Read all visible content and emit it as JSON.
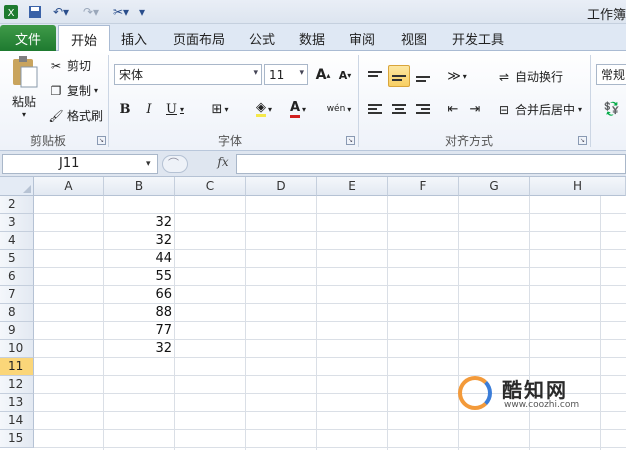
{
  "window": {
    "title": "工作簿"
  },
  "quick_access": {
    "icons": [
      "excel-icon",
      "save-icon",
      "undo-icon",
      "redo-icon",
      "tools-icon",
      "customize-icon"
    ]
  },
  "tabs": {
    "file": "文件",
    "items": [
      {
        "label": "开始",
        "active": true
      },
      {
        "label": "插入",
        "active": false
      },
      {
        "label": "页面布局",
        "active": false
      },
      {
        "label": "公式",
        "active": false
      },
      {
        "label": "数据",
        "active": false
      },
      {
        "label": "审阅",
        "active": false
      },
      {
        "label": "视图",
        "active": false
      },
      {
        "label": "开发工具",
        "active": false
      }
    ]
  },
  "ribbon": {
    "clipboard": {
      "label": "剪贴板",
      "paste": "粘贴",
      "cut": "剪切",
      "copy": "复制",
      "format_painter": "格式刷"
    },
    "font": {
      "label": "字体",
      "font_name": "宋体",
      "font_size": "11",
      "bold": "B",
      "italic": "I",
      "underline": "U",
      "grow": "A",
      "shrink": "A",
      "font_color": "A",
      "wen": "wén"
    },
    "alignment": {
      "label": "对齐方式",
      "wrap_text": "自动换行",
      "merge_center": "合并后居中"
    },
    "number": {
      "format": "常规"
    }
  },
  "formula_bar": {
    "name_box": "J11",
    "fx": "fx",
    "value": ""
  },
  "sheet": {
    "columns": [
      "A",
      "B",
      "C",
      "D",
      "E",
      "F",
      "G",
      "H"
    ],
    "rows": [
      "2",
      "3",
      "4",
      "5",
      "6",
      "7",
      "8",
      "9",
      "10",
      "11",
      "12",
      "13",
      "14",
      "15"
    ],
    "selected_row": "11",
    "column_b_values": [
      "",
      "32",
      "32",
      "44",
      "55",
      "66",
      "88",
      "77",
      "32",
      "",
      "",
      "",
      "",
      ""
    ]
  },
  "watermark": {
    "name": "酷知网",
    "url": "www.coozhi.com"
  },
  "colors": {
    "file_tab": "#1e7a30",
    "selected_row_header": "#fbd679",
    "active_align": "#f8cf63"
  }
}
